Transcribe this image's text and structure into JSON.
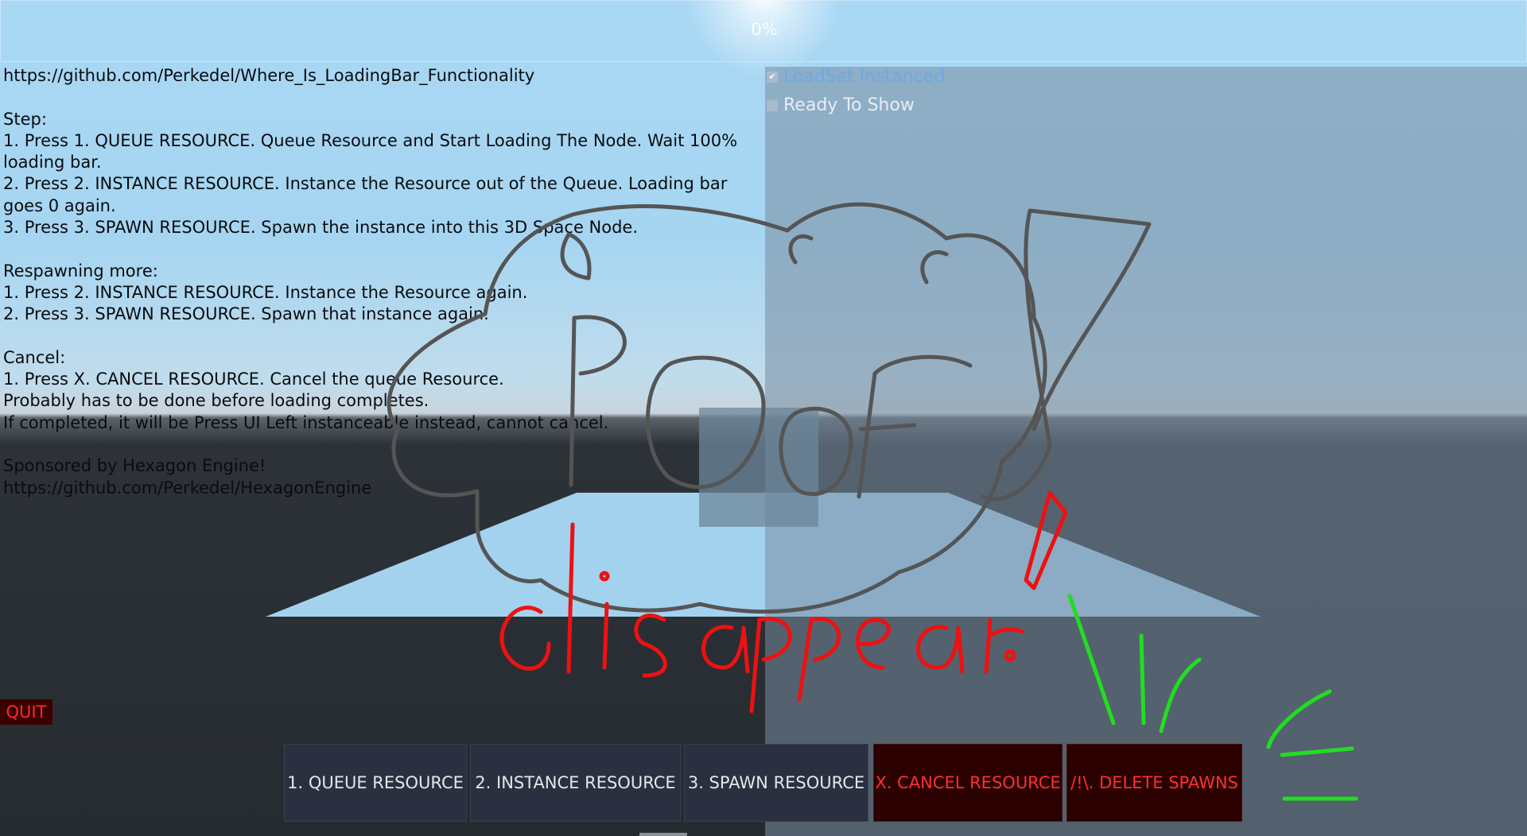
{
  "loading": {
    "percent_label": "0%",
    "progress": 0
  },
  "checkboxes": {
    "loadset_instanced": {
      "label": "LoadSet Instanced",
      "checked": true
    },
    "ready_to_show": {
      "label": "Ready To Show",
      "checked": false
    }
  },
  "instructions": {
    "text": "https://github.com/Perkedel/Where_Is_LoadingBar_Functionality\n\nStep:\n1. Press 1. QUEUE RESOURCE. Queue Resource and Start Loading The Node. Wait 100% loading bar.\n2. Press 2. INSTANCE RESOURCE. Instance the Resource out of the Queue. Loading bar goes 0 again.\n3. Press 3. SPAWN RESOURCE. Spawn the instance into this 3D Space Node.\n\nRespawning more:\n1. Press 2. INSTANCE RESOURCE. Instance the Resource again.\n2. Press 3. SPAWN RESOURCE. Spawn that instance again.\n\nCancel:\n1. Press X. CANCEL RESOURCE. Cancel the queue Resource.\nProbably has to be done before loading completes.\nIf completed, it will be Press UI Left instanceable instead, cannot cancel.\n\nSponsored by Hexagon Engine!\nhttps://github.com/Perkedel/HexagonEngine"
  },
  "quit_label": "QUIT",
  "buttons": {
    "queue": "1. QUEUE RESOURCE",
    "instance": "2. INSTANCE RESOURCE",
    "spawn": "3. SPAWN RESOURCE",
    "cancel": "X. CANCEL RESOURCE",
    "delete": "/!\\. DELETE SPAWNS"
  },
  "scribbles": {
    "grey_text": "POOF!",
    "red_text": "disappear!"
  },
  "colors": {
    "danger_text": "#ff3030",
    "scribble_grey": "#555555",
    "scribble_red": "#ee1111",
    "scribble_green": "#22dd22",
    "checkbox_active": "#6fa8e8"
  }
}
